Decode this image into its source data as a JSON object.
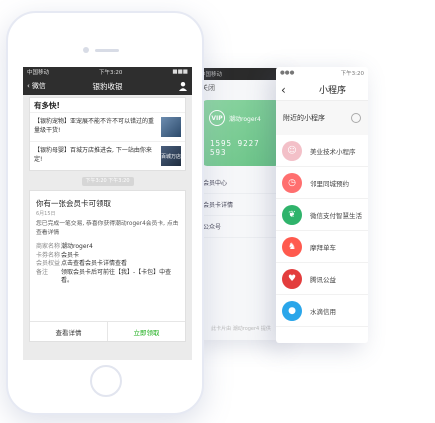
{
  "back_screen": {
    "status": "中国移动",
    "close_label": "关闭",
    "card": {
      "logo": "VIP",
      "name": "潮动roger4",
      "number": "1595 9227 593"
    },
    "rows": [
      "会员中心",
      "会员卡详情",
      "公众号"
    ],
    "footer": "此卡片由 潮动roger4 提供"
  },
  "mini_program": {
    "status_time": "下午3:20",
    "title": "小程序",
    "nearby_label": "附近的小程序",
    "items": [
      {
        "label": "美业技术小程序",
        "icon": "face-icon",
        "color": "#f3c0c8"
      },
      {
        "label": "邻里同城预约",
        "icon": "clock-icon",
        "color": "#ff6f6f"
      },
      {
        "label": "微信支付智慧生活",
        "icon": "leaf-icon",
        "color": "#2fb36b"
      },
      {
        "label": "摩拜单车",
        "icon": "bike-icon",
        "color": "#ff5a4e"
      },
      {
        "label": "腾讯公益",
        "icon": "heart-icon",
        "color": "#e33d3d"
      },
      {
        "label": "水滴信用",
        "icon": "drop-icon",
        "color": "#2aa6ea"
      }
    ]
  },
  "phone": {
    "status": {
      "carrier": "中国移动",
      "time": "下午3:20",
      "battery": "■■■"
    },
    "nav": {
      "back_label": "微信",
      "title": "银豹收银"
    },
    "message_card": {
      "header": "有多快!",
      "items": [
        {
          "text": "【银豹宠物】亚宠展不能不许不可以错过的重量级干货!",
          "thumb": ""
        },
        {
          "text": "【银豹母婴】百城万店推进会, 下一站由你来定!",
          "thumb": "百城万店"
        }
      ]
    },
    "timestamp": "下午3:20 下午3:20",
    "notice": {
      "title": "你有一张会员卡可领取",
      "date": "6月15日",
      "body": "您已完成一笔交易, 恭喜你获得潮动roger4会员卡, 点击查看详情",
      "rows": [
        {
          "key": "商家名称",
          "value": "潮动roger4"
        },
        {
          "key": "卡券名称",
          "value": "会员卡"
        },
        {
          "key": "会员权益",
          "value": "点击查看会员卡详情查看"
        },
        {
          "key": "备注",
          "value": "领取会员卡后可前往【我】-【卡包】中查看。"
        }
      ],
      "view_details": "查看详情",
      "claim_now": "立即领取"
    }
  }
}
